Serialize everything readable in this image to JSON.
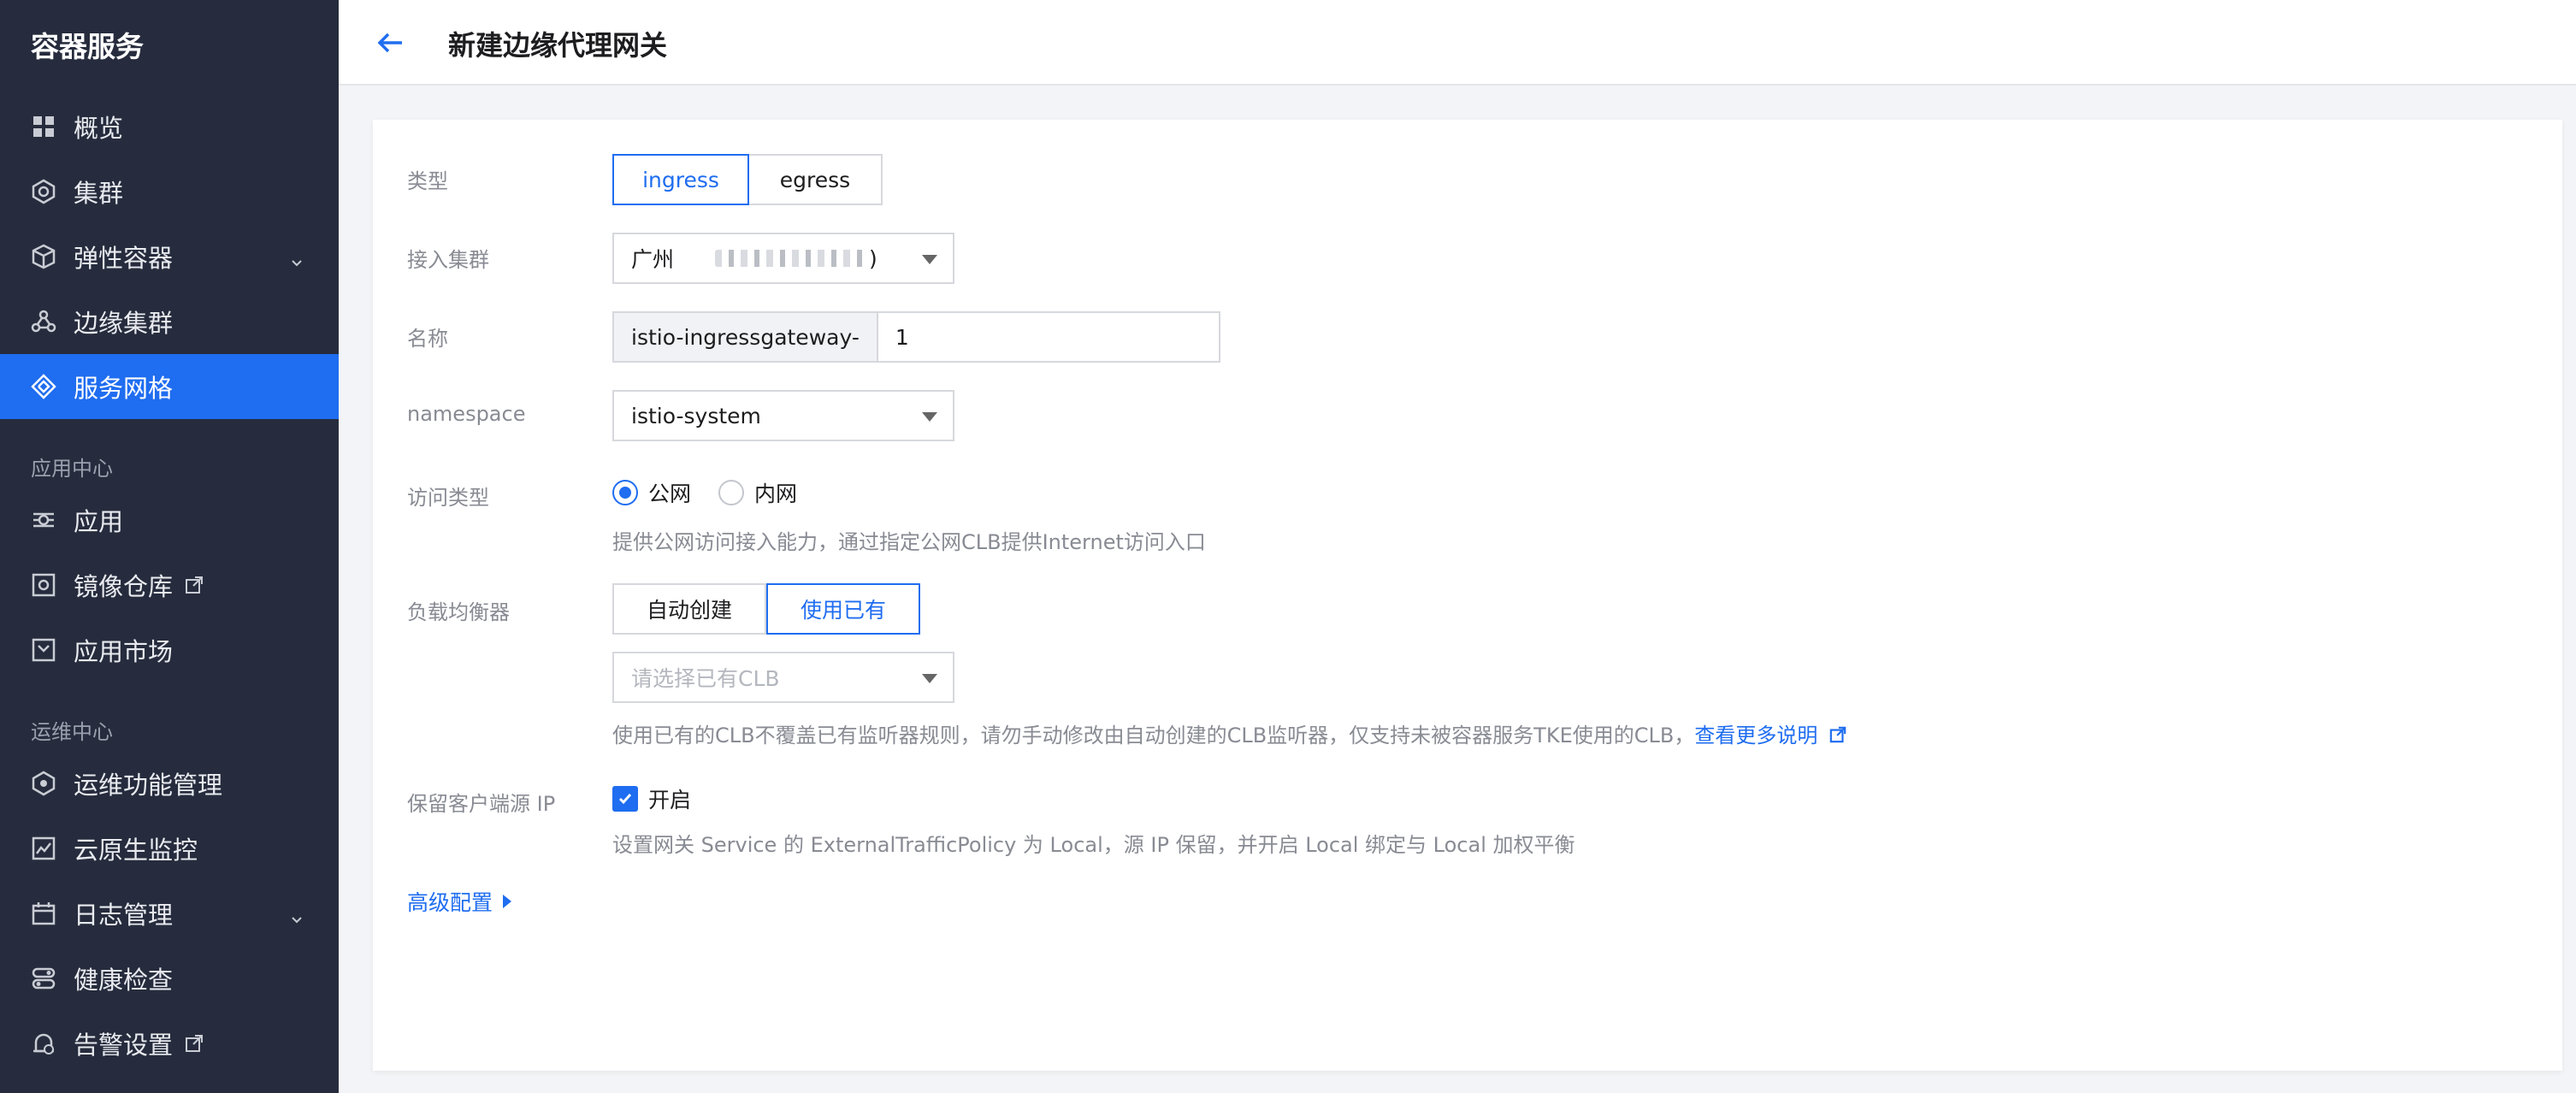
{
  "sidebar": {
    "brand": "容器服务",
    "items": [
      {
        "label": "概览"
      },
      {
        "label": "集群"
      },
      {
        "label": "弹性容器"
      },
      {
        "label": "边缘集群"
      },
      {
        "label": "服务网格"
      }
    ],
    "section_app": "应用中心",
    "app_items": [
      {
        "label": "应用"
      },
      {
        "label": "镜像仓库"
      },
      {
        "label": "应用市场"
      }
    ],
    "section_ops": "运维中心",
    "ops_items": [
      {
        "label": "运维功能管理"
      },
      {
        "label": "云原生监控"
      },
      {
        "label": "日志管理"
      },
      {
        "label": "健康检查"
      },
      {
        "label": "告警设置"
      }
    ]
  },
  "header": {
    "title": "新建边缘代理网关"
  },
  "form": {
    "type_label": "类型",
    "type_options": [
      "ingress",
      "egress"
    ],
    "cluster_label": "接入集群",
    "cluster_value": "广州",
    "cluster_value_suffix": ")",
    "name_label": "名称",
    "name_prefix": "istio-ingressgateway-",
    "name_value": "1",
    "namespace_label": "namespace",
    "namespace_value": "istio-system",
    "access_label": "访问类型",
    "access_options": [
      "公网",
      "内网"
    ],
    "access_help": "提供公网访问接入能力，通过指定公网CLB提供Internet访问入口",
    "lb_label": "负载均衡器",
    "lb_options": [
      "自动创建",
      "使用已有"
    ],
    "clb_placeholder": "请选择已有CLB",
    "lb_help": "使用已有的CLB不覆盖已有监听器规则，请勿手动修改由自动创建的CLB监听器，仅支持未被容器服务TKE使用的CLB，",
    "lb_help_link": "查看更多说明",
    "preserve_ip_label": "保留客户端源 IP",
    "preserve_ip_option": "开启",
    "preserve_ip_help": "设置网关 Service 的 ExternalTrafficPolicy 为 Local，源 IP 保留，并开启 Local 绑定与 Local 加权平衡",
    "advanced": "高级配置"
  },
  "colors": {
    "sidebar_bg": "#262c3d",
    "accent": "#1f6df0"
  }
}
